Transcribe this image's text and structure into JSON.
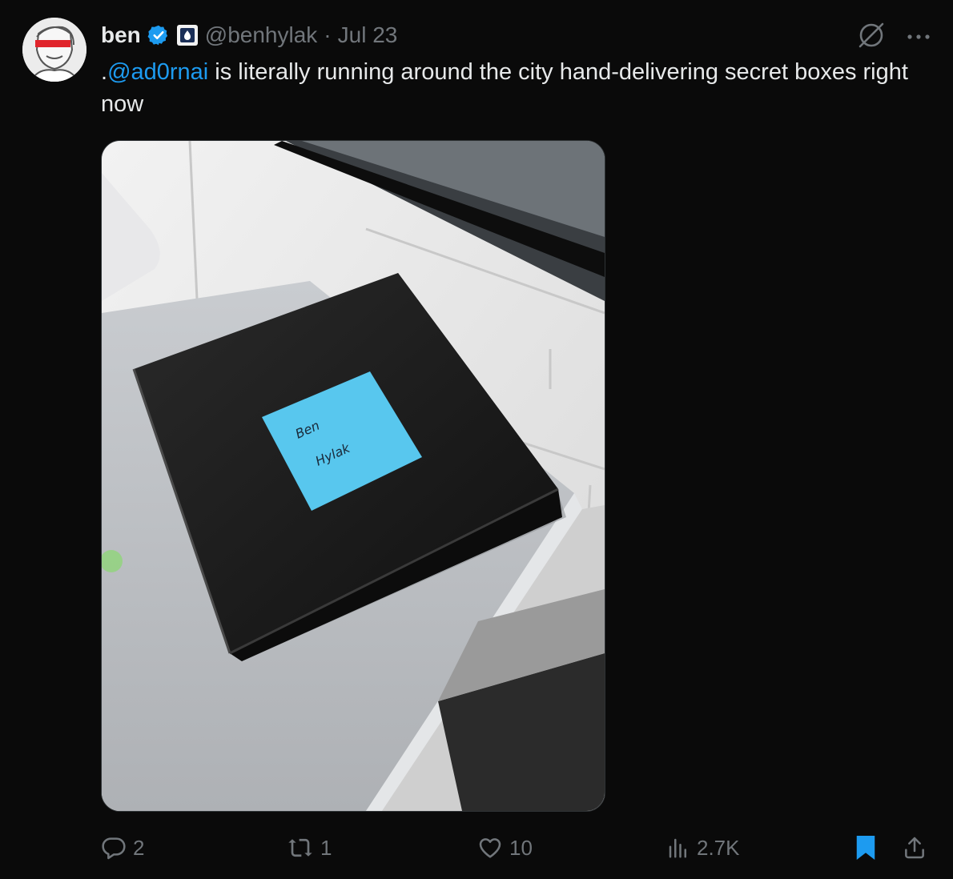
{
  "author": {
    "name": "ben",
    "handle": "@benhylak",
    "separator": "·",
    "date": "Jul 23"
  },
  "tweet": {
    "prefix": ".",
    "mention": "@ad0rnai",
    "text": " is literally running around the city hand-delivering secret boxes right now"
  },
  "media": {
    "note_line1": "Ben",
    "note_line2": "Hylak"
  },
  "actions": {
    "replies": "2",
    "reposts": "1",
    "likes": "10",
    "views": "2.7K"
  },
  "colors": {
    "background": "#0a0a0a",
    "text": "#e7e9ea",
    "muted": "#71767b",
    "accent": "#1d9bf0",
    "sticky_note": "#58c7ee"
  },
  "icons": [
    "verified-badge-icon",
    "affiliate-badge-icon",
    "grok-icon",
    "more-icon",
    "reply-icon",
    "repost-icon",
    "like-icon",
    "views-icon",
    "bookmark-icon",
    "share-icon"
  ]
}
